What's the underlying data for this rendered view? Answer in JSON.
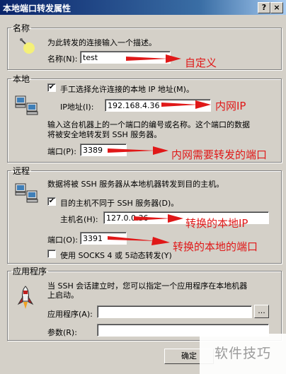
{
  "window": {
    "title": "本地端口转发属性",
    "help": "?",
    "close": "×"
  },
  "name_group": {
    "legend": "名称",
    "desc": "为此转发的连接输入一个描述。",
    "label": "名称(N):",
    "value": "test",
    "annotation": "自定义"
  },
  "local_group": {
    "legend": "本地",
    "checkbox_label": "手工选择允许连接的本地 IP 地址(M)。",
    "checkbox_checked": "✔",
    "ip_label": "IP地址(I):",
    "ip_value": "192.168.4.36",
    "ip_annotation": "内网IP",
    "desc_line1": "输入这台机器上的一个端口的编号或名称。这个端口的数据",
    "desc_line2": "将被安全地转发到 SSH 服务器。",
    "port_label": "端口(P):",
    "port_value": "3389",
    "port_annotation": "内网需要转发的端口"
  },
  "remote_group": {
    "legend": "远程",
    "desc": "数据将被 SSH 服务器从本地机器转发到目的主机。",
    "checkbox_label": "目的主机不同于 SSH 服务器(D)。",
    "checkbox_checked": "✔",
    "host_label": "主机名(H):",
    "host_value": "127.0.0.36",
    "host_annotation": "转换的本地IP",
    "port_label": "端口(O):",
    "port_value": "3391",
    "port_annotation": "转换的本地的端口",
    "socks_label": "使用 SOCKS 4 或 5动态转发(Y)"
  },
  "app_group": {
    "legend": "应用程序",
    "desc_line1": "当 SSH 会话建立时，您可以指定一个应用程序在本地机器",
    "desc_line2": "上启动。",
    "app_label": "应用程序(A):",
    "app_value": "",
    "browse": "...",
    "params_label": "参数(R):",
    "params_value": ""
  },
  "buttons": {
    "ok": "确定"
  },
  "watermark": "软件技巧",
  "colors": {
    "annotation": "#e01818",
    "titlebar": "#0a246a"
  }
}
